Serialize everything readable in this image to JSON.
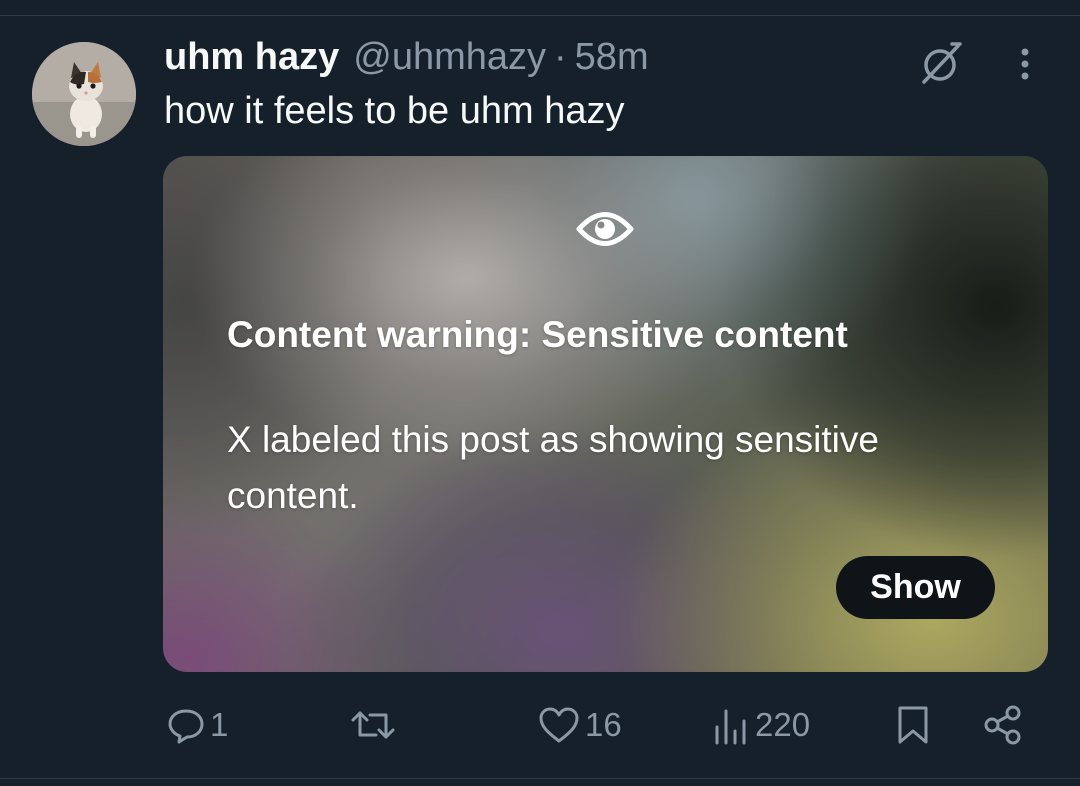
{
  "post": {
    "author": {
      "display_name": "uhm hazy",
      "handle": "@uhmhazy",
      "separator": "·",
      "time": "58m"
    },
    "text": "how it feels to be uhm hazy",
    "media": {
      "warning_title": "Content warning: Sensitive content",
      "warning_description": "X labeled this post as showing sensitive content.",
      "show_label": "Show"
    },
    "actions": {
      "replies": "1",
      "reposts": "",
      "likes": "16",
      "views": "220"
    }
  },
  "icons": {
    "header": [
      "grok-icon",
      "more-options-icon"
    ],
    "media": "eye-icon",
    "actions": [
      "reply-icon",
      "repost-icon",
      "like-icon",
      "views-icon",
      "bookmark-icon",
      "share-icon"
    ]
  },
  "colors": {
    "background": "#15202b",
    "text_primary": "#f7f9f9",
    "text_secondary": "#8b98a5",
    "show_button": "#0f1419"
  }
}
